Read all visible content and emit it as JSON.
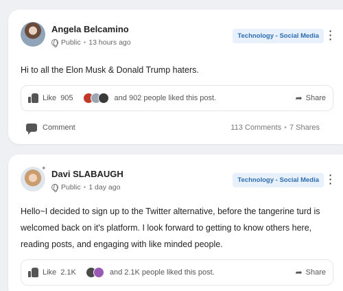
{
  "posts": [
    {
      "author": "Angela Belcamino",
      "visibility": "Public",
      "time": "13 hours ago",
      "tag": "Technology - Social Media",
      "content": "Hi to all the Elon Musk & Donald Trump haters.",
      "like_label": "Like",
      "like_count": "905",
      "liked_text": "and 902 people liked this post.",
      "share_label": "Share",
      "comment_label": "Comment",
      "comments_count": "113 Comments",
      "shares_count": "7 Shares",
      "liker_colors": [
        "#c0392b",
        "#9aa5b1",
        "#3a3a3a"
      ]
    },
    {
      "author": "Davi SLABAUGH",
      "visibility": "Public",
      "time": "1 day ago",
      "tag": "Technology - Social Media",
      "content": "Hello~I decided to sign up to the Twitter alternative, before the tangerine turd is welcomed back on it's platform. I look forward to getting to know others here, reading posts, and engaging with like minded people.",
      "like_label": "Like",
      "like_count": "2.1K",
      "liked_text": "and 2.1K people liked this post.",
      "share_label": "Share",
      "liker_colors": [
        "#4a4a4a",
        "#9b59b6"
      ]
    }
  ],
  "icons": {
    "separator": "•",
    "globe": "globe-icon",
    "thumb": "thumbs-up-icon",
    "share": "share-arrow-icon",
    "comment": "comment-icon",
    "menu": "more-vertical-icon"
  },
  "colors": {
    "tag_bg": "#e8f1fb",
    "tag_text": "#2c6cb0",
    "page_bg": "#eef0f3"
  }
}
